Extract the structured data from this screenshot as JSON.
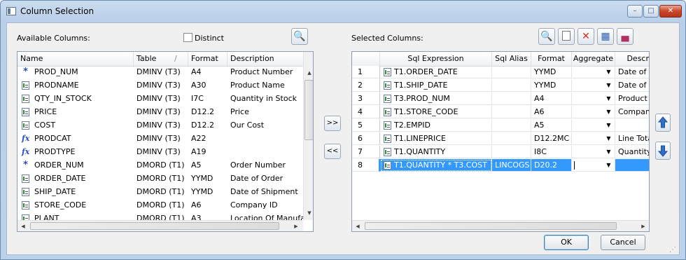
{
  "window": {
    "title": "Column Selection"
  },
  "left": {
    "label": "Available Columns:",
    "distinct_label": "Distinct",
    "columns": [
      "Name",
      "Table",
      "Format",
      "Description"
    ],
    "rows": [
      {
        "icon": "key",
        "name": "PROD_NUM",
        "table": "DMINV (T3)",
        "format": "A4",
        "desc": "Product Number"
      },
      {
        "icon": "field",
        "name": "PRODNAME",
        "table": "DMINV (T3)",
        "format": "A30",
        "desc": "Product Name"
      },
      {
        "icon": "field",
        "name": "QTY_IN_STOCK",
        "table": "DMINV (T3)",
        "format": "I7C",
        "desc": "Quantity in Stock"
      },
      {
        "icon": "field",
        "name": "PRICE",
        "table": "DMINV (T3)",
        "format": "D12.2",
        "desc": "Price"
      },
      {
        "icon": "field",
        "name": "COST",
        "table": "DMINV (T3)",
        "format": "D12.2",
        "desc": "Our Cost"
      },
      {
        "icon": "fx",
        "name": "PRODCAT",
        "table": "DMINV (T3)",
        "format": "A22",
        "desc": ""
      },
      {
        "icon": "fx",
        "name": "PRODTYPE",
        "table": "DMINV (T3)",
        "format": "A19",
        "desc": ""
      },
      {
        "icon": "key",
        "name": "ORDER_NUM",
        "table": "DMORD (T1)",
        "format": "A5",
        "desc": "Order Number"
      },
      {
        "icon": "field",
        "name": "ORDER_DATE",
        "table": "DMORD (T1)",
        "format": "YYMD",
        "desc": "Date of Order"
      },
      {
        "icon": "field",
        "name": "SHIP_DATE",
        "table": "DMORD (T1)",
        "format": "YYMD",
        "desc": "Date of Shipment"
      },
      {
        "icon": "field",
        "name": "STORE_CODE",
        "table": "DMORD (T1)",
        "format": "A6",
        "desc": "Company ID"
      },
      {
        "icon": "field",
        "name": "PLANT",
        "table": "DMORD (T1)",
        "format": "A3",
        "desc": "Location Of Manufact"
      }
    ]
  },
  "middle": {
    "add_label": ">>",
    "remove_label": "<<"
  },
  "right": {
    "label": "Selected Columns:",
    "columns": [
      "",
      "Sql Expression",
      "Sql Alias",
      "Format",
      "Aggregate",
      "Descr"
    ],
    "rows": [
      {
        "n": "1",
        "expr": "T1.ORDER_DATE",
        "alias": "",
        "format": "YYMD",
        "desc": "Date of Order"
      },
      {
        "n": "2",
        "expr": "T1.SHIP_DATE",
        "alias": "",
        "format": "YYMD",
        "desc": "Date of Shipment"
      },
      {
        "n": "3",
        "expr": "T3.PROD_NUM",
        "alias": "",
        "format": "A4",
        "desc": "Product Number"
      },
      {
        "n": "4",
        "expr": "T1.STORE_CODE",
        "alias": "",
        "format": "A6",
        "desc": "Company ID"
      },
      {
        "n": "5",
        "expr": "T2.EMPID",
        "alias": "",
        "format": "A5",
        "desc": ""
      },
      {
        "n": "6",
        "expr": "T1.LINEPRICE",
        "alias": "",
        "format": "D12.2MC",
        "desc": "Line Total"
      },
      {
        "n": "7",
        "expr": "T1.QUANTITY",
        "alias": "",
        "format": "I8C",
        "desc": "Quantity"
      },
      {
        "n": "8",
        "expr": "T1.QUANTITY * T3.COST",
        "alias": "LINCOGS",
        "format": "D20.2",
        "desc": ""
      }
    ]
  },
  "buttons": {
    "ok": "OK",
    "cancel": "Cancel"
  },
  "colors": {
    "selection": "#3399ff",
    "title_bg": "#c4d8ef",
    "close": "#c9472b"
  }
}
